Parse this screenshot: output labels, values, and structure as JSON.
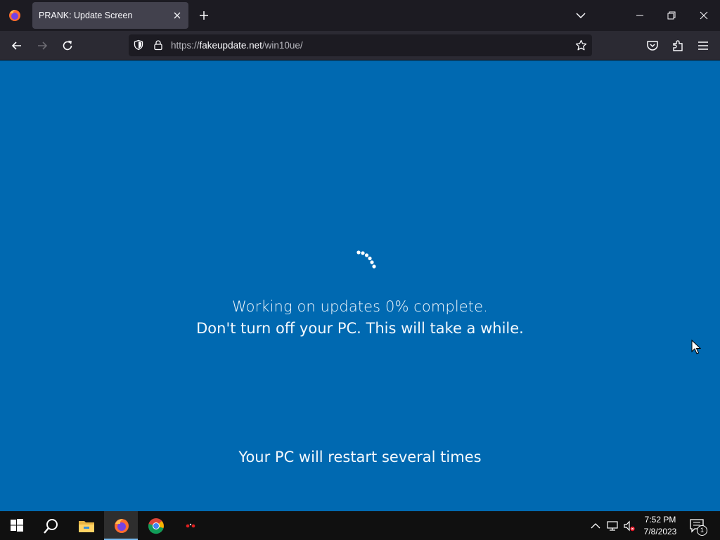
{
  "browser": {
    "tab": {
      "title": "PRANK: Update Screen"
    },
    "url": {
      "scheme": "https://",
      "host": "fakeupdate.net",
      "path": "/win10ue/"
    }
  },
  "page": {
    "status_line1": "Working on updates  0% complete.",
    "status_line2": "Don't turn off your PC. This will take a while.",
    "progress_percent": 0,
    "restart_note": "Your PC will restart several times",
    "background_color": "#0069b1"
  },
  "taskbar": {
    "icons": [
      "windows-start-icon",
      "search-icon",
      "file-explorer-icon",
      "firefox-icon",
      "chrome-icon",
      "app-icon"
    ],
    "active_app": "firefox-icon",
    "tray_icons": [
      "chevron-up-icon",
      "network-icon",
      "volume-muted-icon"
    ],
    "clock_time": "7:52 PM",
    "clock_date": "7/8/2023",
    "notification_count": "1"
  }
}
